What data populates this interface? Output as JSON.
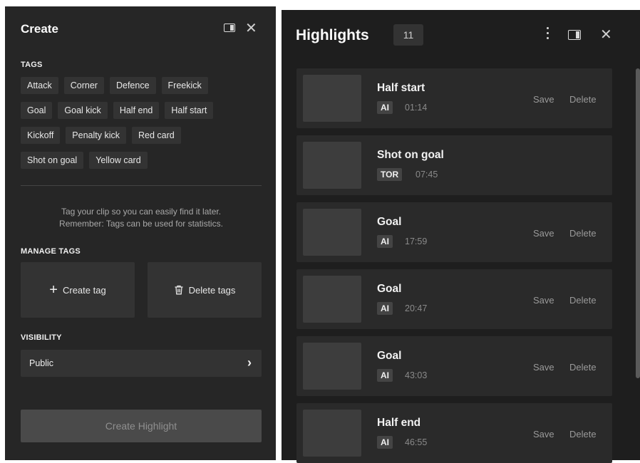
{
  "create_panel": {
    "title": "Create",
    "tags_label": "TAGS",
    "tags": [
      [
        "Attack",
        "Corner",
        "Defence",
        "Freekick"
      ],
      [
        "Goal",
        "Goal kick",
        "Half end",
        "Half start"
      ],
      [
        "Kickoff",
        "Penalty kick",
        "Red card"
      ],
      [
        "Shot on goal",
        "Yellow card"
      ]
    ],
    "hint_line1": "Tag your clip so you can easily find it later.",
    "hint_line2": "Remember: Tags can be used for statistics.",
    "manage_tags_label": "MANAGE TAGS",
    "create_tag_label": "Create tag",
    "delete_tags_label": "Delete tags",
    "visibility_label": "VISIBILITY",
    "visibility_value": "Public",
    "create_highlight_label": "Create Highlight",
    "icons": [
      "panel-toggle-icon",
      "close-icon",
      "plus-icon",
      "trash-icon",
      "chevron-right-icon"
    ]
  },
  "highlights_panel": {
    "title": "Highlights",
    "count": "11",
    "items": [
      {
        "title": "Half start",
        "source": "AI",
        "time": "01:14",
        "save": "Save",
        "delete": "Delete"
      },
      {
        "title": "Shot on goal",
        "source": "TOR",
        "time": "07:45",
        "save": "",
        "delete": ""
      },
      {
        "title": "Goal",
        "source": "AI",
        "time": "17:59",
        "save": "Save",
        "delete": "Delete"
      },
      {
        "title": "Goal",
        "source": "AI",
        "time": "20:47",
        "save": "Save",
        "delete": "Delete"
      },
      {
        "title": "Goal",
        "source": "AI",
        "time": "43:03",
        "save": "Save",
        "delete": "Delete"
      },
      {
        "title": "Half end",
        "source": "AI",
        "time": "46:55",
        "save": "Save",
        "delete": "Delete"
      }
    ],
    "icons": [
      "kebab-menu-icon",
      "panel-toggle-icon",
      "close-icon"
    ]
  },
  "colors": {
    "panel_bg": "#262626",
    "list_bg": "#1e1e1e",
    "chip_bg": "#333333",
    "disabled_button": "#4a4a4a"
  }
}
